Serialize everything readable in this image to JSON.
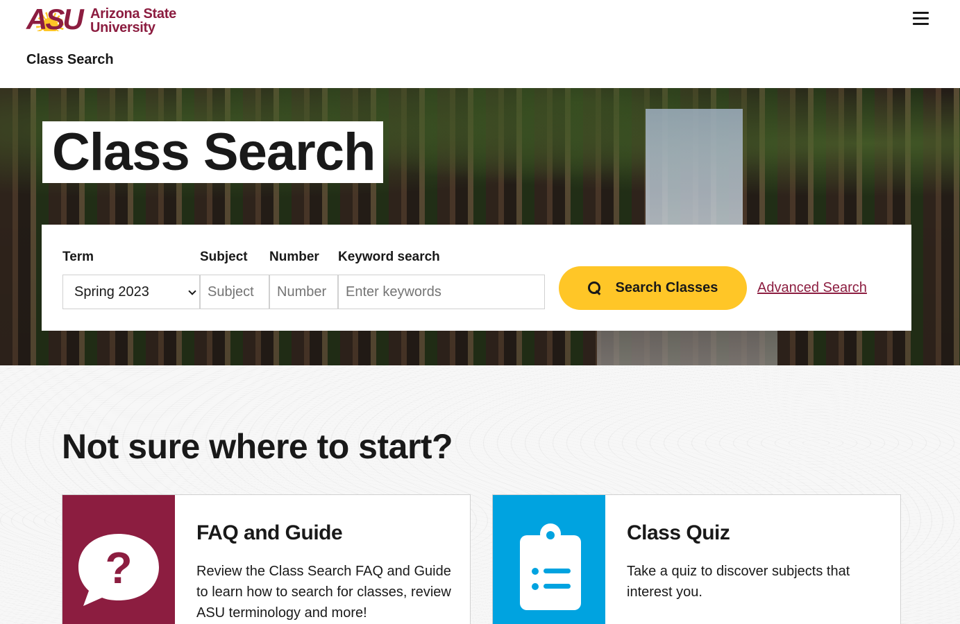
{
  "header": {
    "logo_text_line1": "Arizona State",
    "logo_text_line2": "University",
    "logo_mark": "ASU",
    "site_title": "Class Search",
    "menu_icon": "hamburger-icon"
  },
  "hero": {
    "title": "Class Search"
  },
  "search": {
    "term_label": "Term",
    "term_value": "Spring 2023",
    "subject_label": "Subject",
    "subject_placeholder": "Subject",
    "number_label": "Number",
    "number_placeholder": "Number",
    "keyword_label": "Keyword search",
    "keyword_placeholder": "Enter keywords",
    "search_button_label": "Search Classes",
    "search_button_icon": "search-icon",
    "advanced_link": "Advanced Search"
  },
  "lower": {
    "heading": "Not sure where to start?",
    "cards": [
      {
        "title": "FAQ and Guide",
        "text": "Review the Class Search FAQ and Guide to learn how to search for classes, review ASU terminology and more!",
        "icon": "question-bubble-icon",
        "color": "#8c1d40"
      },
      {
        "title": "Class Quiz",
        "text": "Take a quiz to discover subjects that interest you.",
        "icon": "clipboard-icon",
        "color": "#00a3e0"
      }
    ]
  },
  "colors": {
    "maroon": "#8c1d40",
    "gold": "#ffc627",
    "blue": "#00a3e0"
  }
}
